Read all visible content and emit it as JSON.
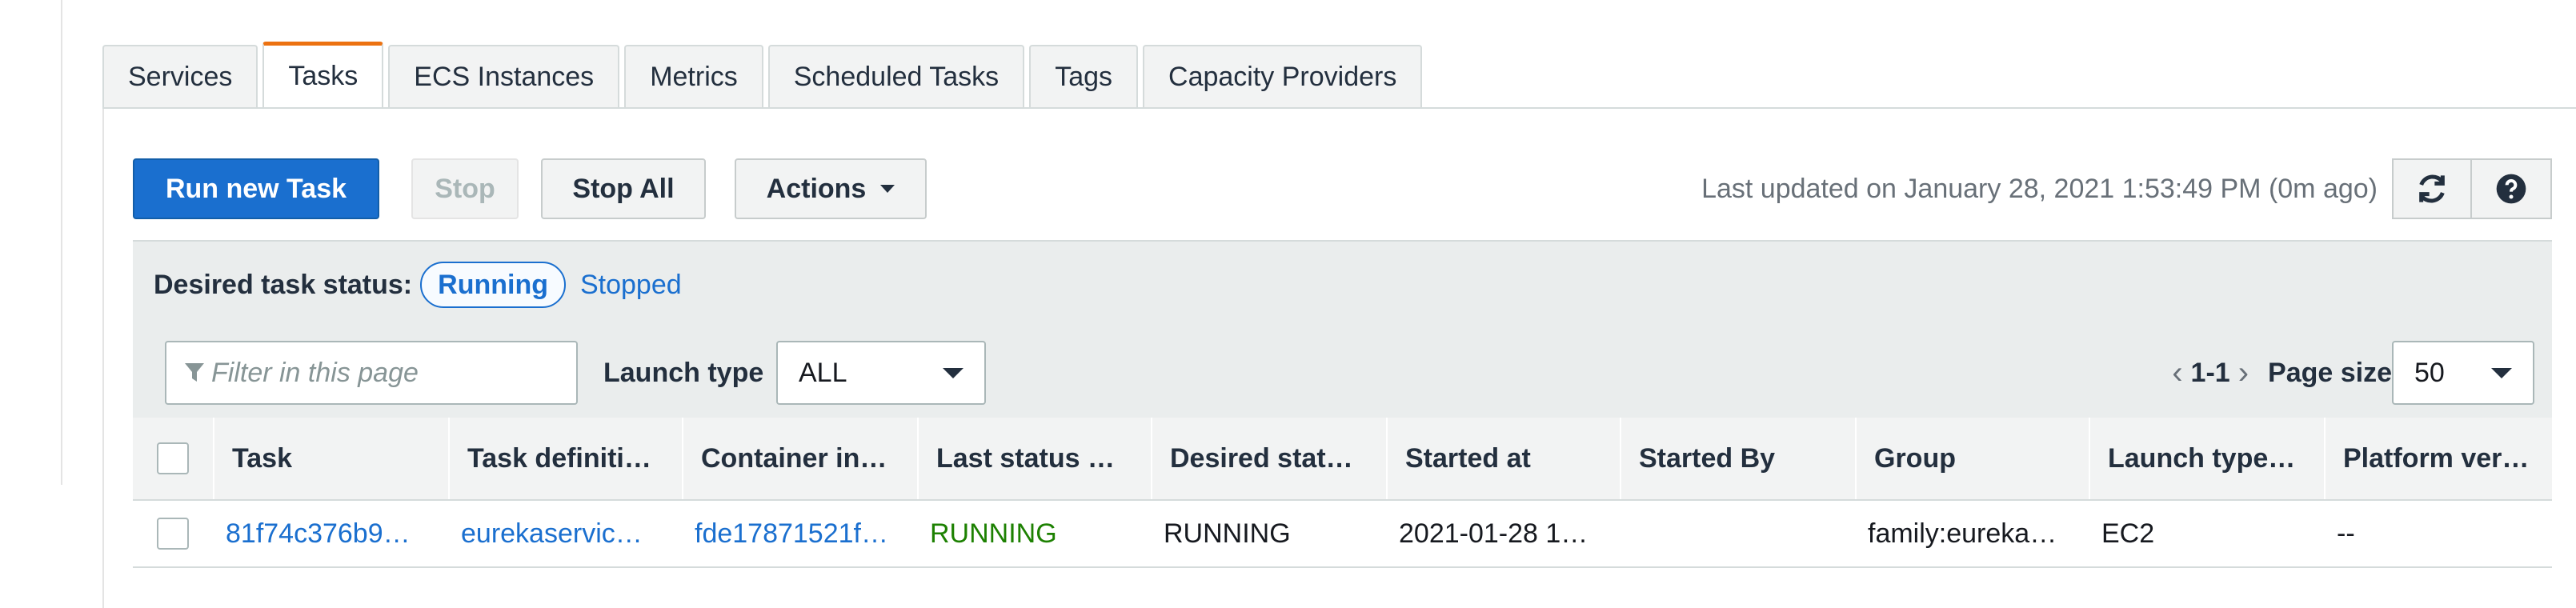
{
  "tabs": [
    {
      "label": "Services",
      "active": false
    },
    {
      "label": "Tasks",
      "active": true
    },
    {
      "label": "ECS Instances",
      "active": false
    },
    {
      "label": "Metrics",
      "active": false
    },
    {
      "label": "Scheduled Tasks",
      "active": false
    },
    {
      "label": "Tags",
      "active": false
    },
    {
      "label": "Capacity Providers",
      "active": false
    }
  ],
  "toolbar": {
    "run_label": "Run new Task",
    "stop_label": "Stop",
    "stop_all_label": "Stop All",
    "actions_label": "Actions",
    "last_updated": "Last updated on January 28, 2021 1:53:49 PM (0m ago)",
    "refresh_icon": "refresh-icon",
    "help_icon": "help-icon"
  },
  "status": {
    "label": "Desired task status:",
    "running": "Running",
    "stopped": "Stopped"
  },
  "filter": {
    "placeholder": "Filter in this page",
    "launch_type_label": "Launch type",
    "launch_type_value": "ALL",
    "range": "1-1",
    "page_size_label": "Page size",
    "page_size_value": "50"
  },
  "table": {
    "columns": [
      "Task",
      "Task definiti…",
      "Container in…",
      "Last status …",
      "Desired stat…",
      "Started at",
      "Started By",
      "Group",
      "Launch type…",
      "Platform ver…"
    ],
    "rows": [
      {
        "task": "81f74c376b9…",
        "task_definition": "eurekaservic…",
        "container_instance": "fde17871521f…",
        "last_status": "RUNNING",
        "desired_status": "RUNNING",
        "started_at": "2021-01-28 1…",
        "started_by": "",
        "group": "family:eureka…",
        "launch_type": "EC2",
        "platform_version": "--"
      }
    ]
  },
  "colors": {
    "primary": "#1a6fcf",
    "active_tab_accent": "#ec7211",
    "running_green": "#1d8102"
  }
}
